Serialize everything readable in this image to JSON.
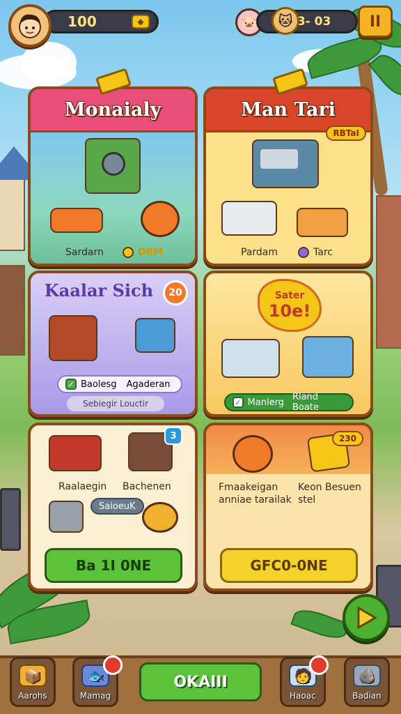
{
  "topbar": {
    "coins": "100",
    "energy": "73- 03",
    "pause_label": "II"
  },
  "cards": [
    {
      "title": "Monaialy",
      "label_a": "Sardarn",
      "label_b": "DBM"
    },
    {
      "title": "Man Tari",
      "corner_tag": "RBTaI",
      "label_a": "Pardam",
      "label_b": "Tarc"
    },
    {
      "title": "Kaalar Sich",
      "badge": "20",
      "chip_a": "Baolesg",
      "chip_b": "Agaderan",
      "chip_c": "Sebiegir Louctir"
    },
    {
      "title": "",
      "burst_line1": "Sater",
      "burst_line2": "10e!",
      "chip_a": "Manlerg",
      "chip_b": "Rland Boate"
    },
    {
      "title": "",
      "badge": "3",
      "label_a": "Raalaegin",
      "label_b": "Bachenen",
      "chip": "SaioeuK",
      "button": "Ba 1I 0NE"
    },
    {
      "title": "",
      "badge": "230",
      "text_a": "Fmaakeigan\nanniae tarailak",
      "text_b": "Keon Besuen\nstel",
      "button": "GFC0-0NE"
    }
  ],
  "bottom_nav": [
    {
      "label": "Aarohs",
      "icon": "box-icon"
    },
    {
      "label": "Mamag",
      "icon": "fish-icon",
      "dot": ""
    },
    {
      "label": "OKAIII",
      "icon": ""
    },
    {
      "label": "Haoac",
      "icon": "person-icon",
      "dot": ""
    },
    {
      "label": "Badian",
      "icon": "stone-icon"
    }
  ],
  "colors": {
    "frame": "#8a4a1a",
    "pink_head": "#e94f7a",
    "red_head": "#d8462a",
    "green_btn": "#5cc23a",
    "yellow_btn": "#f5d22a"
  }
}
